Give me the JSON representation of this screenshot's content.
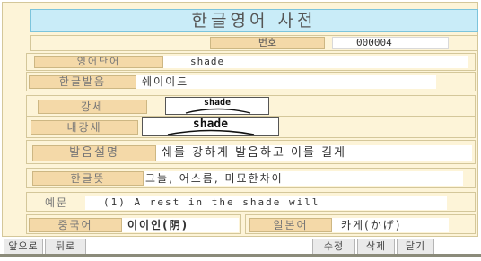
{
  "title": "한글영어 사전",
  "number": {
    "label": "번호",
    "value": "000004"
  },
  "fields": {
    "english_word": {
      "label": "영어단어",
      "value": "shade"
    },
    "korean_pronunciation": {
      "label": "한글발음",
      "value": "쉐이이드"
    },
    "stress": {
      "label": "강세",
      "value": "shade"
    },
    "inner_stress": {
      "label": "내강세",
      "value": "shade"
    },
    "pronunciation_note": {
      "label": "발음설명",
      "value": "쉐를 강하게 발음하고 이를 길게"
    },
    "korean_meaning": {
      "label": "한글뜻",
      "value": "그늘, 어스름, 미묘한차이"
    },
    "example": {
      "label": "예문",
      "value": "(1) A rest in the shade will"
    },
    "chinese": {
      "label": "중국어",
      "value": "이이인(阴)"
    },
    "japanese": {
      "label": "일본어",
      "value": "카게(かげ)"
    }
  },
  "buttons": {
    "prev": "앞으로",
    "next": "뒤로",
    "edit": "수정",
    "delete": "삭제",
    "close": "닫기"
  }
}
